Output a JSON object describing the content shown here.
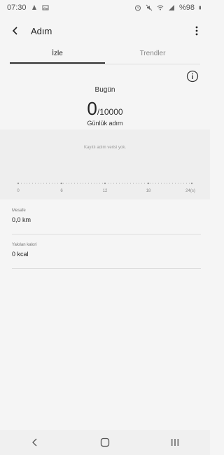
{
  "status_bar": {
    "time": "07:30",
    "battery": "%98",
    "icons": [
      "notification-icon",
      "image-icon",
      "alarm-icon",
      "mute-icon",
      "wifi-icon",
      "signal-icon",
      "battery-icon"
    ]
  },
  "app_bar": {
    "title": "Adım",
    "icons": [
      "back-arrow-icon",
      "more-vert-icon"
    ]
  },
  "tabs": [
    {
      "label": "İzle",
      "active": true
    },
    {
      "label": "Trendler",
      "active": false
    }
  ],
  "summary": {
    "today_label": "Bugün",
    "steps": "0",
    "goal": "/10000",
    "daily_label": "Günlük adım"
  },
  "chart_data": {
    "type": "bar",
    "no_data_text": "Kayıtlı adım verisi yok.",
    "x_ticks": [
      "0",
      "6",
      "12",
      "18",
      "24(s)"
    ],
    "values": []
  },
  "metrics": [
    {
      "label": "Mesafe",
      "value": "0,0 km"
    },
    {
      "label": "Yakılan kalori",
      "value": "0 kcal"
    }
  ],
  "nav": {
    "icons": [
      "nav-back-icon",
      "home-icon",
      "recents-icon"
    ]
  },
  "colors": {
    "background": "#f5f5f5",
    "chart_background": "#eeeeee",
    "text": "#222222",
    "muted": "#888888"
  }
}
